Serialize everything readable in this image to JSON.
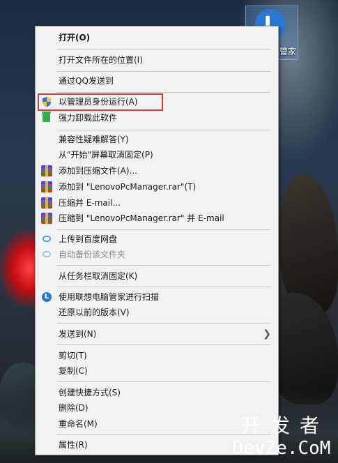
{
  "desktop_icon": {
    "glyph": "L",
    "label": "管家"
  },
  "menu": {
    "items": [
      {
        "label": "打开(O)"
      },
      {
        "label": "打开文件所在的位置(I)"
      },
      {
        "label": "通过QQ发送到"
      },
      {
        "label": "以管理员身份运行(A)",
        "icon": "shield-icon"
      },
      {
        "label": "强力卸载此软件",
        "icon": "trash-icon"
      },
      {
        "label": "兼容性疑难解答(Y)"
      },
      {
        "label": "从\"开始\"屏幕取消固定(P)"
      },
      {
        "label": "添加到压缩文件(A)...",
        "icon": "winrar-icon"
      },
      {
        "label": "添加到 \"LenovoPcManager.rar\"(T)",
        "icon": "winrar-icon"
      },
      {
        "label": "压缩并 E-mail...",
        "icon": "winrar-icon"
      },
      {
        "label": "压缩到 \"LenovoPcManager.rar\" 并 E-mail",
        "icon": "winrar-icon"
      },
      {
        "label": "上传到百度网盘",
        "icon": "baidu-cloud-icon"
      },
      {
        "label": "自动备份该文件夹",
        "icon": "baidu-cloud-icon",
        "disabled": true
      },
      {
        "label": "从任务栏取消固定(K)"
      },
      {
        "label": "使用联想电脑管家进行扫描",
        "icon": "lenovo-icon"
      },
      {
        "label": "还原以前的版本(V)"
      },
      {
        "label": "发送到(N)",
        "submenu": true
      },
      {
        "label": "剪切(T)"
      },
      {
        "label": "复制(C)"
      },
      {
        "label": "创建快捷方式(S)"
      },
      {
        "label": "删除(D)"
      },
      {
        "label": "重命名(M)"
      },
      {
        "label": "属性(R)"
      }
    ],
    "highlight_color": "#d23a3a"
  },
  "watermark": {
    "line1": "开发者",
    "line2": "DevZe.CoM"
  }
}
